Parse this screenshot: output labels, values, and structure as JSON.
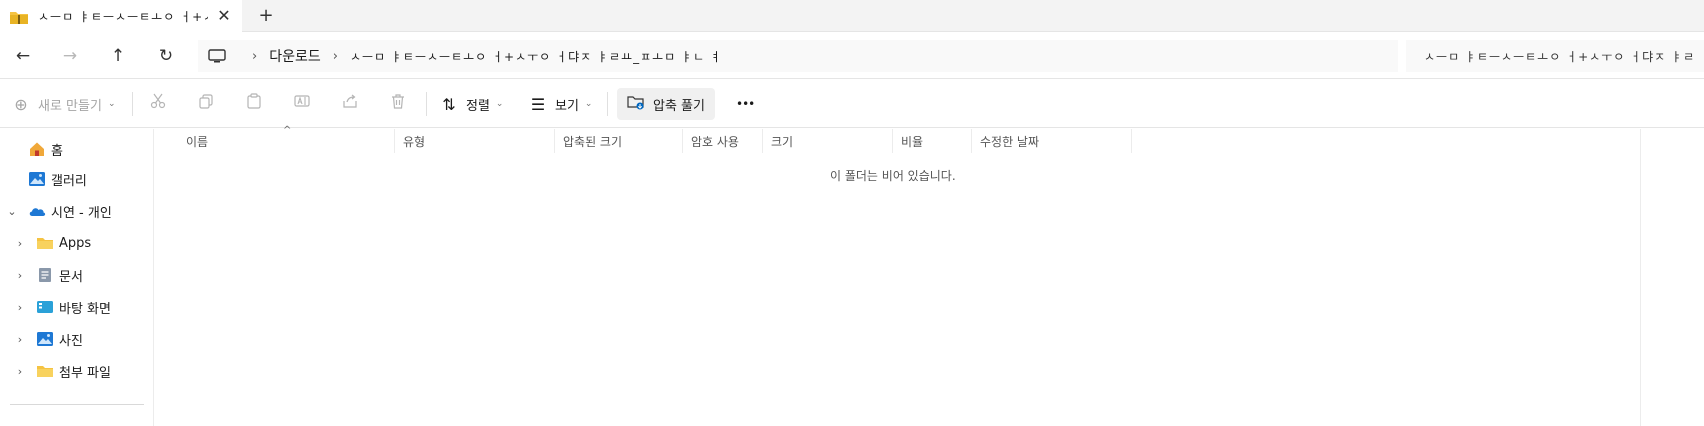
{
  "tab": {
    "title": "ㅅㅡㅁ ㅑㅌㅡㅅㅡㅌㅗㅇ ㅓ+ㅅ",
    "close_glyph": "✕",
    "new_tab_glyph": "+"
  },
  "address": {
    "back_glyph": "←",
    "forward_glyph": "→",
    "up_glyph": "↑",
    "refresh_glyph": "↻",
    "crumb_sep": "›",
    "crumb_downloads": "다운로드",
    "crumb_folder": "ㅅㅡㅁ ㅑㅌㅡㅅㅡㅌㅗㅇ ㅓ+ㅅㅜㅇ ㅓ댜ㅈ ㅑㄹㅛ_ㅍㅗㅁ ㅑㄴ ㅕ",
    "search_text": "ㅅㅡㅁ ㅑㅌㅡㅅㅡㅌㅗㅇ ㅓ+ㅅㅜㅇ ㅓ댜ㅈ ㅑㄹ"
  },
  "commands": {
    "new_label": "새로 만들기",
    "sort_label": "정렬",
    "view_label": "보기",
    "extract_label": "압축 풀기",
    "more_glyph": "•••",
    "chevron": "⌄"
  },
  "sidebar": {
    "home": "홈",
    "gallery": "갤러리",
    "onedrive": "시연 - 개인",
    "apps": "Apps",
    "documents": "문서",
    "desktop": "바탕 화면",
    "pictures": "사진",
    "attachments": "첨부 파일"
  },
  "columns": {
    "name": "이름",
    "type": "유형",
    "compressed_size": "압축된 크기",
    "password": "암호 사용",
    "size": "크기",
    "ratio": "비율",
    "modified": "수정한 날짜",
    "sort_caret": "^"
  },
  "empty_message": "이 폴더는 비어 있습니다.",
  "colors": {
    "folder_yellow": "#f5c342",
    "cloud_blue": "#1e78d4",
    "accent_blue": "#0067c0"
  }
}
